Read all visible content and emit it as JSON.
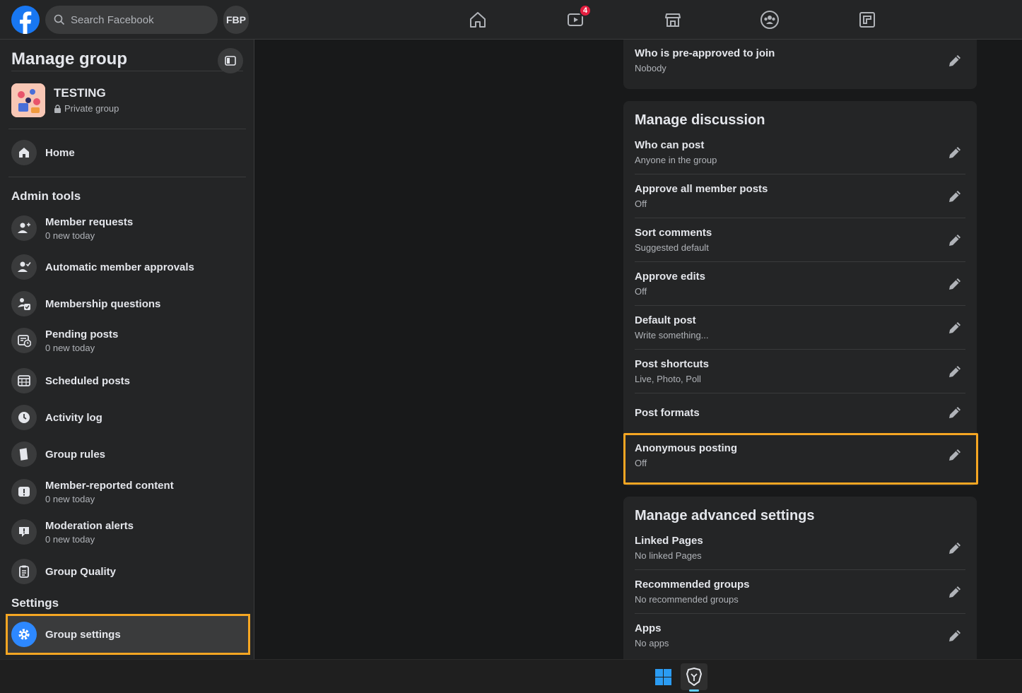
{
  "topbar": {
    "search_placeholder": "Search Facebook",
    "profile_initials": "FBP",
    "watch_badge": "4",
    "icons": [
      "home-icon",
      "watch-icon",
      "marketplace-icon",
      "groups-icon",
      "gaming-icon"
    ]
  },
  "sidebar": {
    "title": "Manage group",
    "group": {
      "name": "TESTING",
      "privacy": "Private group"
    },
    "home_label": "Home",
    "admin_tools_heading": "Admin tools",
    "items": [
      {
        "label": "Member requests",
        "sub": "0 new today",
        "icon": "member-requests-icon"
      },
      {
        "label": "Automatic member approvals",
        "sub": "",
        "icon": "auto-approve-icon"
      },
      {
        "label": "Membership questions",
        "sub": "",
        "icon": "membership-questions-icon"
      },
      {
        "label": "Pending posts",
        "sub": "0 new today",
        "icon": "pending-posts-icon"
      },
      {
        "label": "Scheduled posts",
        "sub": "",
        "icon": "scheduled-posts-icon"
      },
      {
        "label": "Activity log",
        "sub": "",
        "icon": "clock-icon"
      },
      {
        "label": "Group rules",
        "sub": "",
        "icon": "rules-book-icon"
      },
      {
        "label": "Member-reported content",
        "sub": "0 new today",
        "icon": "alert-icon"
      },
      {
        "label": "Moderation alerts",
        "sub": "0 new today",
        "icon": "moderation-alert-icon"
      },
      {
        "label": "Group Quality",
        "sub": "",
        "icon": "clipboard-icon"
      }
    ],
    "settings_heading": "Settings",
    "active_item": {
      "label": "Group settings",
      "icon": "gear-icon"
    }
  },
  "main": {
    "top_panel": {
      "rows": [
        {
          "label": "Who is pre-approved to join",
          "value": "Nobody"
        }
      ]
    },
    "discussion_panel": {
      "title": "Manage discussion",
      "rows": [
        {
          "label": "Who can post",
          "value": "Anyone in the group"
        },
        {
          "label": "Approve all member posts",
          "value": "Off"
        },
        {
          "label": "Sort comments",
          "value": "Suggested default"
        },
        {
          "label": "Approve edits",
          "value": "Off"
        },
        {
          "label": "Default post",
          "value": "Write something..."
        },
        {
          "label": "Post shortcuts",
          "value": "Live, Photo, Poll"
        },
        {
          "label": "Post formats",
          "value": ""
        },
        {
          "label": "Anonymous posting",
          "value": "Off"
        }
      ]
    },
    "advanced_panel": {
      "title": "Manage advanced settings",
      "rows": [
        {
          "label": "Linked Pages",
          "value": "No linked Pages"
        },
        {
          "label": "Recommended groups",
          "value": "No recommended groups"
        },
        {
          "label": "Apps",
          "value": "No apps"
        }
      ]
    }
  },
  "colors": {
    "accent": "#1877f2",
    "highlight": "#f5a623",
    "panel_bg": "#242526",
    "page_bg": "#18191a"
  }
}
